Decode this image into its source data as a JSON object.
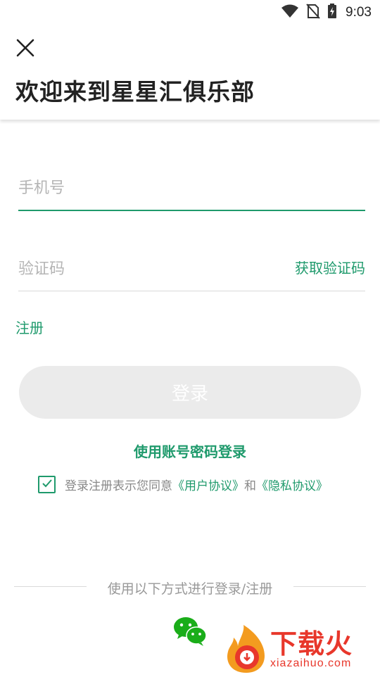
{
  "status_bar": {
    "time": "9:03",
    "icons": [
      "wifi-icon",
      "no-sim-icon",
      "battery-charging-icon"
    ]
  },
  "header": {
    "close_icon": "close-icon",
    "title": "欢迎来到星星汇俱乐部"
  },
  "form": {
    "phone_placeholder": "手机号",
    "phone_value": "",
    "code_placeholder": "验证码",
    "code_value": "",
    "get_code_label": "获取验证码",
    "register_label": "注册",
    "login_label": "登录",
    "password_login_label": "使用账号密码登录"
  },
  "agreement": {
    "checked": true,
    "prefix": "登录注册表示您同意",
    "user_agreement": "《用户协议》",
    "conjunction": "和",
    "privacy_policy": "《隐私协议》"
  },
  "alt_login": {
    "divider_text": "使用以下方式进行登录/注册",
    "providers": [
      "wechat-icon"
    ]
  },
  "watermark": {
    "name": "下载火",
    "url": "xiazaihuo.com"
  },
  "colors": {
    "accent": "#1f9a6c",
    "button_disabled": "#ebebeb",
    "watermark": "#e8372b"
  }
}
